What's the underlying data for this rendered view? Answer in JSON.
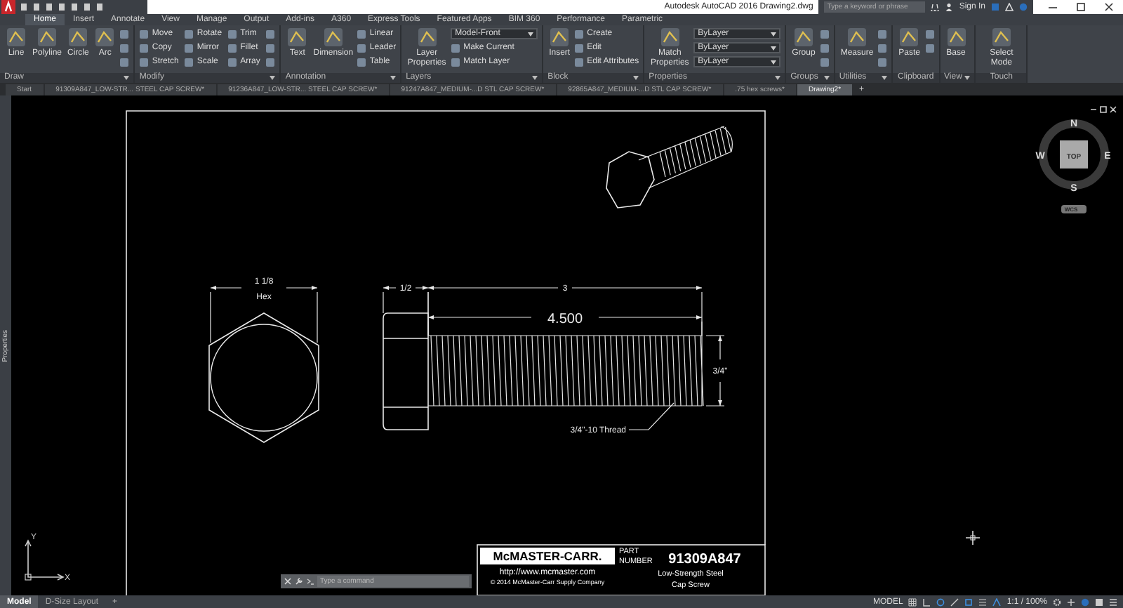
{
  "title_bar": {
    "app_title": "Autodesk AutoCAD 2016",
    "document": "Drawing2.dwg",
    "search": {
      "placeholder": "Type a keyword or phrase"
    },
    "sign_in": "Sign In"
  },
  "ribbon_tabs": [
    {
      "label": "Home",
      "selected": true
    },
    {
      "label": "Insert",
      "selected": false
    },
    {
      "label": "Annotate",
      "selected": false
    },
    {
      "label": "View",
      "selected": false
    },
    {
      "label": "Manage",
      "selected": false
    },
    {
      "label": "Output",
      "selected": false
    },
    {
      "label": "Add-ins",
      "selected": false
    },
    {
      "label": "A360",
      "selected": false
    },
    {
      "label": "Express Tools",
      "selected": false
    },
    {
      "label": "Featured Apps",
      "selected": false
    },
    {
      "label": "BIM 360",
      "selected": false
    },
    {
      "label": "Performance",
      "selected": false
    },
    {
      "label": "Parametric",
      "selected": false
    }
  ],
  "ribbon_panels": [
    {
      "title": "Draw",
      "expandable": true,
      "items": [
        {
          "kind": "large",
          "label": "Line"
        },
        {
          "kind": "large",
          "label": "Polyline"
        },
        {
          "kind": "large",
          "label": "Circle"
        },
        {
          "kind": "large",
          "label": "Arc"
        },
        {
          "kind": "small"
        },
        {
          "kind": "small"
        },
        {
          "kind": "small"
        }
      ]
    },
    {
      "title": "Modify",
      "expandable": true,
      "items": [
        {
          "kind": "small",
          "label": "Move"
        },
        {
          "kind": "small",
          "label": "Copy"
        },
        {
          "kind": "small",
          "label": "Stretch"
        },
        {
          "kind": "small",
          "label": "Rotate"
        },
        {
          "kind": "small",
          "label": "Mirror"
        },
        {
          "kind": "small",
          "label": "Scale"
        },
        {
          "kind": "small",
          "label": "Trim"
        },
        {
          "kind": "small",
          "label": "Fillet"
        },
        {
          "kind": "small",
          "label": "Array"
        },
        {
          "kind": "small"
        },
        {
          "kind": "small"
        },
        {
          "kind": "small"
        }
      ]
    },
    {
      "title": "Annotation",
      "expandable": true,
      "items": [
        {
          "kind": "large",
          "label": "Text"
        },
        {
          "kind": "large",
          "label": "Dimension"
        },
        {
          "kind": "small",
          "label": "Linear"
        },
        {
          "kind": "small",
          "label": "Leader"
        },
        {
          "kind": "small",
          "label": "Table"
        }
      ]
    },
    {
      "title": "Layers",
      "expandable": true,
      "items": [
        {
          "kind": "large",
          "label": "Layer Properties"
        },
        {
          "kind": "combo",
          "label": "Model-Front"
        },
        {
          "kind": "small",
          "label": "Make Current"
        },
        {
          "kind": "small",
          "label": "Match Layer"
        }
      ]
    },
    {
      "title": "Block",
      "expandable": true,
      "items": [
        {
          "kind": "large",
          "label": "Insert"
        },
        {
          "kind": "small",
          "label": "Create"
        },
        {
          "kind": "small",
          "label": "Edit"
        },
        {
          "kind": "small",
          "label": "Edit Attributes"
        }
      ]
    },
    {
      "title": "Properties",
      "expandable": true,
      "items": [
        {
          "kind": "large",
          "label": "Match Properties"
        },
        {
          "kind": "combo",
          "label": "ByLayer"
        },
        {
          "kind": "combo",
          "label": "ByLayer"
        },
        {
          "kind": "combo",
          "label": "ByLayer"
        }
      ]
    },
    {
      "title": "Groups",
      "expandable": true,
      "items": [
        {
          "kind": "large",
          "label": "Group"
        },
        {
          "kind": "small"
        },
        {
          "kind": "small"
        },
        {
          "kind": "small"
        }
      ]
    },
    {
      "title": "Utilities",
      "expandable": true,
      "items": [
        {
          "kind": "large",
          "label": "Measure"
        },
        {
          "kind": "small"
        },
        {
          "kind": "small"
        },
        {
          "kind": "small"
        }
      ]
    },
    {
      "title": "Clipboard",
      "expandable": false,
      "items": [
        {
          "kind": "large",
          "label": "Paste"
        },
        {
          "kind": "small"
        },
        {
          "kind": "small"
        }
      ]
    },
    {
      "title": "View",
      "expandable": true,
      "items": [
        {
          "kind": "large",
          "label": "Base"
        }
      ]
    },
    {
      "title": "Touch",
      "expandable": false,
      "items": [
        {
          "kind": "large",
          "label": "Select Mode"
        }
      ]
    }
  ],
  "file_tabs": [
    {
      "label": "Start",
      "selected": false
    },
    {
      "label": "91309A847_LOW-STR... STEEL CAP SCREW*",
      "selected": false
    },
    {
      "label": "91236A847_LOW-STR... STEEL CAP SCREW*",
      "selected": false
    },
    {
      "label": "91247A847_MEDIUM-...D STL CAP SCREW*",
      "selected": false
    },
    {
      "label": "92865A847_MEDIUM-...D STL CAP SCREW*",
      "selected": false
    },
    {
      "label": ".75 hex screws*",
      "selected": false
    },
    {
      "label": "Drawing2*",
      "selected": true
    }
  ],
  "new_tab": "+",
  "palette": {
    "title": "Properties"
  },
  "drawing": {
    "hex_width": "1 1/8",
    "hex_label": "Hex",
    "head_height": "1/2",
    "thread_length": "3",
    "overall_length": "4.500",
    "diameter": "3/4\"",
    "thread_callout": "3/4\"-10 Thread"
  },
  "title_block": {
    "logo": "McMASTER-CARR.",
    "part_label": "PART",
    "number_label": "NUMBER",
    "part_number": "91309A847",
    "url": "http://www.mcmaster.com",
    "copyright": "© 2014 McMaster-Carr Supply Company",
    "description": [
      "Low-Strength Steel",
      "Cap Screw"
    ]
  },
  "viewcube": {
    "north": "N",
    "south": "S",
    "east": "E",
    "west": "W",
    "face": "TOP",
    "coordinate_system": "WCS"
  },
  "ucs": {
    "x": "X",
    "y": "Y"
  },
  "command_line": {
    "placeholder": "Type a command"
  },
  "status_bar": {
    "layout_tabs": [
      {
        "label": "Model",
        "selected": true
      },
      {
        "label": "D-Size Layout",
        "selected": false
      }
    ],
    "add_layout": "+",
    "space": "MODEL",
    "scale": "1:1 / 100%"
  }
}
